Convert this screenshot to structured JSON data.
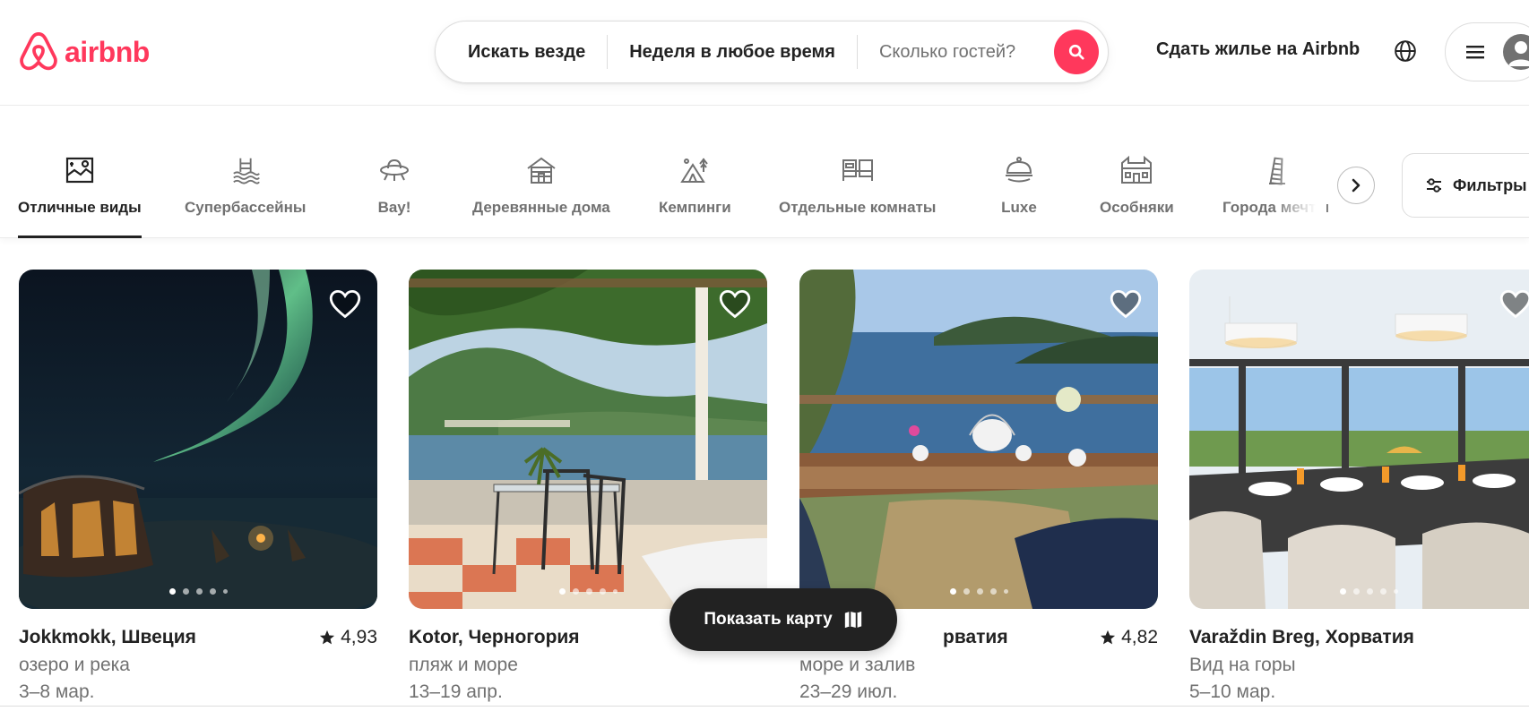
{
  "brand": {
    "name": "airbnb",
    "accent": "#FF385C"
  },
  "search": {
    "where": "Искать везде",
    "when": "Неделя в любое время",
    "guests_placeholder": "Сколько гостей?"
  },
  "header": {
    "host_link": "Сдать жилье на Airbnb"
  },
  "categories": [
    {
      "label": "Отличные виды",
      "icon": "map-view-icon",
      "active": true
    },
    {
      "label": "Супербассейны",
      "icon": "pool-icon"
    },
    {
      "label": "Вау!",
      "icon": "ufo-icon"
    },
    {
      "label": "Деревянные дома",
      "icon": "cabin-icon"
    },
    {
      "label": "Кемпинги",
      "icon": "camping-icon"
    },
    {
      "label": "Отдельные комнаты",
      "icon": "private-room-icon"
    },
    {
      "label": "Luxe",
      "icon": "luxe-cloche-icon"
    },
    {
      "label": "Особняки",
      "icon": "mansion-icon"
    },
    {
      "label": "Города мечты",
      "icon": "tower-icon"
    }
  ],
  "filters": {
    "label": "Фильтры"
  },
  "listings": [
    {
      "location": "Jokkmokk, Швеция",
      "rating": "4,93",
      "subtitle": "озеро и река",
      "dates": "3–8 мар."
    },
    {
      "location": "Kotor, Черногория",
      "rating": "",
      "subtitle": "пляж и море",
      "dates": "13–19 апр."
    },
    {
      "location": "рватия",
      "rating": "4,82",
      "subtitle": "море и залив",
      "dates": "23–29 июл."
    },
    {
      "location": "Varaždin Breg, Хорватия",
      "rating": "",
      "subtitle": "Вид на горы",
      "dates": "5–10 мар."
    }
  ],
  "map_button": {
    "label": "Показать карту"
  }
}
